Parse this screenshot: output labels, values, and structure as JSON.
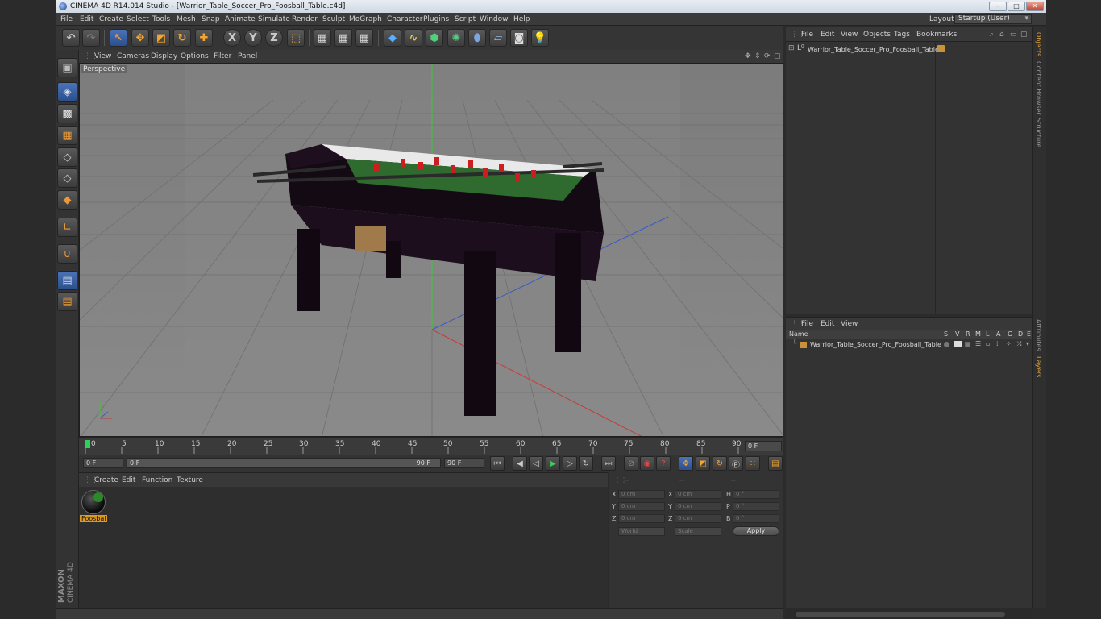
{
  "window": {
    "title": "CINEMA 4D R14.014 Studio - [Warrior_Table_Soccer_Pro_Foosball_Table.c4d]",
    "min_label": "–",
    "max_label": "□",
    "close_label": "✕"
  },
  "menubar": {
    "items": [
      "File",
      "Edit",
      "Create",
      "Select",
      "Tools",
      "Mesh",
      "Snap",
      "Animate",
      "Simulate",
      "Render",
      "Sculpt",
      "MoGraph",
      "Character",
      "Plugins",
      "Script",
      "Window",
      "Help"
    ],
    "layout_label": "Layout:",
    "layout_value": "Startup (User)"
  },
  "toolbar": {
    "axis_x": "X",
    "axis_y": "Y",
    "axis_z": "Z"
  },
  "viewport": {
    "menu": [
      "View",
      "Cameras",
      "Display",
      "Options",
      "Filter",
      "Panel"
    ],
    "label": "Perspective"
  },
  "timeline": {
    "ticks": [
      "0",
      "5",
      "10",
      "15",
      "20",
      "25",
      "30",
      "35",
      "40",
      "45",
      "50",
      "55",
      "60",
      "65",
      "70",
      "75",
      "80",
      "85",
      "90"
    ],
    "frame_display": "0 F",
    "start_field": "0 F",
    "range_start": "0 F",
    "range_end": "90 F",
    "end_field": "90 F"
  },
  "material_manager": {
    "menu": [
      "Create",
      "Edit",
      "Function",
      "Texture"
    ],
    "material_name": "Foosbal"
  },
  "coordinates": {
    "headers": [
      "--",
      "--",
      "--"
    ],
    "rows": [
      {
        "l1": "X",
        "v1": "0 cm",
        "l2": "X",
        "v2": "0 cm",
        "l3": "H",
        "v3": "0 °"
      },
      {
        "l1": "Y",
        "v1": "0 cm",
        "l2": "Y",
        "v2": "0 cm",
        "l3": "P",
        "v3": "0 °"
      },
      {
        "l1": "Z",
        "v1": "0 cm",
        "l2": "Z",
        "v2": "0 cm",
        "l3": "B",
        "v3": "0 °"
      }
    ],
    "world_select": "World",
    "scale_select": "Scale",
    "apply_label": "Apply"
  },
  "object_manager": {
    "menu": [
      "File",
      "Edit",
      "View",
      "Objects",
      "Tags",
      "Bookmarks"
    ],
    "object_name": "Warrior_Table_Soccer_Pro_Foosball_Table"
  },
  "layer_manager": {
    "menu": [
      "File",
      "Edit",
      "View"
    ],
    "col_name": "Name",
    "cols": [
      "S",
      "V",
      "R",
      "M",
      "L",
      "A",
      "G",
      "D",
      "E"
    ],
    "layer_name": "Warrior_Table_Soccer_Pro_Foosball_Table"
  },
  "side_tabs": {
    "top": [
      "Objects",
      "Content Browser",
      "Structure"
    ],
    "bottom": [
      "Attributes",
      "Layers"
    ]
  },
  "branding": {
    "maxon": "MAXON",
    "cinema": "CINEMA 4D"
  },
  "colors": {
    "accent": "#e09a22",
    "selection_blue": "#3b62a6",
    "axis_x": "#c83a3a",
    "axis_y": "#3ac83a",
    "axis_z": "#3a5ac8"
  }
}
